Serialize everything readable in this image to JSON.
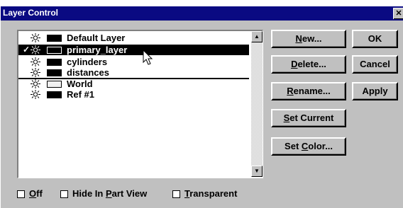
{
  "window": {
    "title": "Layer Control"
  },
  "layers": [
    {
      "label": "Default Layer",
      "current": false,
      "selected": false,
      "swatch": "#000000"
    },
    {
      "label": "primary_layer",
      "current": true,
      "selected": true,
      "swatch": "#000000"
    },
    {
      "label": "cylinders",
      "current": false,
      "selected": false,
      "swatch": "#000000"
    },
    {
      "label": "distances",
      "current": false,
      "selected": false,
      "swatch": "#000000"
    },
    {
      "label": "World",
      "current": false,
      "selected": false,
      "swatch": "#f0f0f0"
    },
    {
      "label": "Ref #1",
      "current": false,
      "selected": false,
      "swatch": "#000000"
    }
  ],
  "check_mark": "✓",
  "buttons": {
    "new": {
      "pre": "",
      "mn": "N",
      "post": "ew..."
    },
    "delete": {
      "pre": "",
      "mn": "D",
      "post": "elete..."
    },
    "rename": {
      "pre": "",
      "mn": "R",
      "post": "ename..."
    },
    "set_current": {
      "pre": "",
      "mn": "S",
      "post": "et Current"
    },
    "set_color": {
      "pre": "Set ",
      "mn": "C",
      "post": "olor..."
    },
    "ok": "OK",
    "cancel": "Cancel",
    "apply": "Apply"
  },
  "checkboxes": {
    "off": {
      "pre": "",
      "mn": "O",
      "post": "ff",
      "checked": false
    },
    "hide": {
      "pre": "Hide In ",
      "mn": "P",
      "post": "art View",
      "checked": false
    },
    "transparent": {
      "pre": "",
      "mn": "T",
      "post": "ransparent",
      "checked": false
    }
  },
  "icons": {
    "bulb": "light-bulb-icon",
    "up": "scroll-up-arrow-icon",
    "down": "scroll-down-arrow-icon",
    "cursor": "mouse-pointer-icon"
  }
}
